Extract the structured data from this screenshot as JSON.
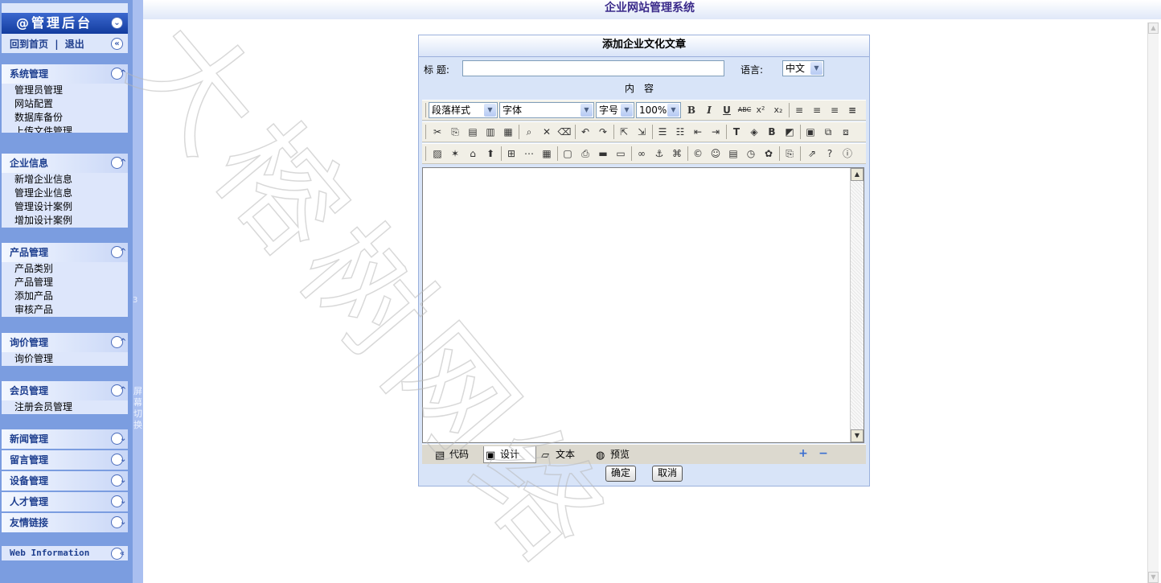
{
  "app": {
    "title": "企业网站管理系统"
  },
  "sidebar": {
    "header": "@管理后台",
    "home_link": "回到首页",
    "link_separator": "|",
    "logout_link": "退出",
    "collapse_glyph": "«",
    "menus": [
      {
        "title": "系统管理",
        "items": [
          "管理员管理",
          "网站配置",
          "数据库备份",
          "上传文件管理"
        ]
      },
      {
        "title": "企业信息",
        "items": [
          "新增企业信息",
          "管理企业信息",
          "管理设计案例",
          "增加设计案例"
        ]
      },
      {
        "title": "产品管理",
        "items": [
          "产品类别",
          "产品管理",
          "添加产品",
          "审核产品"
        ]
      },
      {
        "title": "询价管理",
        "items": [
          "询价管理"
        ]
      },
      {
        "title": "会员管理",
        "items": [
          "注册会员管理"
        ]
      }
    ],
    "collapsed_menus": [
      "新闻管理",
      "留言管理",
      "设备管理",
      "人才管理",
      "友情链接"
    ],
    "web_info": "Web Information",
    "strip_number": "3",
    "screen_switch": "屏幕切换"
  },
  "form": {
    "panel_title": "添加企业文化文章",
    "title_label": "标  题:",
    "title_value": "",
    "language_label": "语言:",
    "language_value": "中文",
    "content_label": "内容",
    "editor": {
      "paragraph_style": "段落样式",
      "font": "字体",
      "font_size": "字号",
      "zoom": "100%",
      "modes": [
        "代码",
        "设计",
        "文本",
        "预览"
      ]
    },
    "confirm_label": "确定",
    "cancel_label": "取消"
  },
  "watermark": "大榕树网络",
  "colors": {
    "sidebar_bg": "#7b9de0",
    "header_bg": "#123c9e",
    "panel_bg": "#d8e4f8",
    "title_text": "#3a2a8a"
  }
}
